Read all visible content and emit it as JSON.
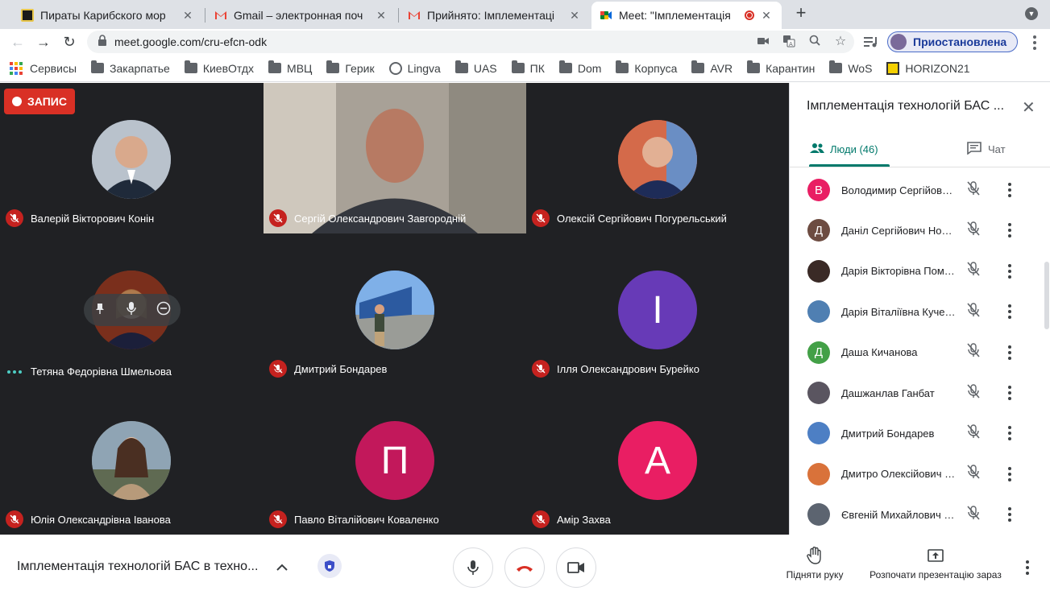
{
  "browser": {
    "tabs": [
      {
        "title": "Пираты Карибского мор",
        "favicon_color": "#1a1a1a",
        "active": false
      },
      {
        "title": "Gmail – электронная поч",
        "favicon_color": "#ea4335",
        "active": false
      },
      {
        "title": "Прийнято: Імплементаці",
        "favicon_color": "#ea4335",
        "active": false
      },
      {
        "title": "Meet: \"Імплементація",
        "favicon_color": "#00832d",
        "active": true
      }
    ],
    "url": "meet.google.com/cru-efcn-odk",
    "profile_label": "Приостановлена",
    "bookmarks": [
      "Сервисы",
      "Закарпатье",
      "КиевОтдх",
      "МВЦ",
      "Герик",
      "Lingva",
      "UAS",
      "ПК",
      "Dom",
      "Корпуса",
      "AVR",
      "Карантин",
      "WoS",
      "HORIZON21"
    ]
  },
  "meet": {
    "recording_label": "ЗАПИС",
    "tiles": [
      {
        "name": "Валерій Вікторович Конін",
        "avatar_color": "#6b7f9a",
        "muted": true
      },
      {
        "name": "Сергій Олександрович Завгородній",
        "avatar_color": "#8a8275",
        "muted": true,
        "video": true
      },
      {
        "name": "Олексій Сергійович Погурельський",
        "avatar_color": "#c2493b",
        "muted": true
      },
      {
        "name": "Тетяна Федорівна Шмельова",
        "avatar_color": "#8a3d22",
        "muted": false,
        "speaking": true
      },
      {
        "name": "Дмитрий Бондарев",
        "avatar_color": "#4d7fc4",
        "muted": true
      },
      {
        "name": "Ілля Олександрович Бурейко",
        "avatar_color": "#673ab7",
        "initial": "І",
        "muted": true
      },
      {
        "name": "Юлія Олександрівна Іванова",
        "avatar_color": "#7d7a6e",
        "muted": true
      },
      {
        "name": "Павло Віталійович Коваленко",
        "avatar_color": "#c2185b",
        "initial": "П",
        "muted": true
      },
      {
        "name": "Амір Захва",
        "avatar_color": "#e91e63",
        "initial": "А",
        "muted": true
      }
    ],
    "meeting_name": "Імплементація технологій БАС в техно...",
    "raise_hand_label": "Підняти руку",
    "present_label": "Розпочати презентацію зараз"
  },
  "panel": {
    "title": "Імплементація технологій БАС ...",
    "people_tab": "Люди (46)",
    "chat_tab": "Чат",
    "people": [
      {
        "name": "Володимир Сергійови...",
        "initial": "В",
        "color": "#e91e63"
      },
      {
        "name": "Даніл Сергійович Носар",
        "initial": "Д",
        "color": "#6d4c41"
      },
      {
        "name": "Дарія Вікторівна Пома...",
        "initial": "",
        "color": "#3a2a26"
      },
      {
        "name": "Дарія Віталіївна Кучерук",
        "initial": "",
        "color": "#4f7fb2"
      },
      {
        "name": "Даша Кичанова",
        "initial": "Д",
        "color": "#43a047"
      },
      {
        "name": "Дашжанлав Ганбат",
        "initial": "",
        "color": "#5a5560"
      },
      {
        "name": "Дмитрий Бондарев",
        "initial": "",
        "color": "#4d7fc4"
      },
      {
        "name": "Дмитро Олексійович Б...",
        "initial": "",
        "color": "#d9723a"
      },
      {
        "name": "Євгеній Михайлович С...",
        "initial": "",
        "color": "#5c6470"
      }
    ]
  }
}
